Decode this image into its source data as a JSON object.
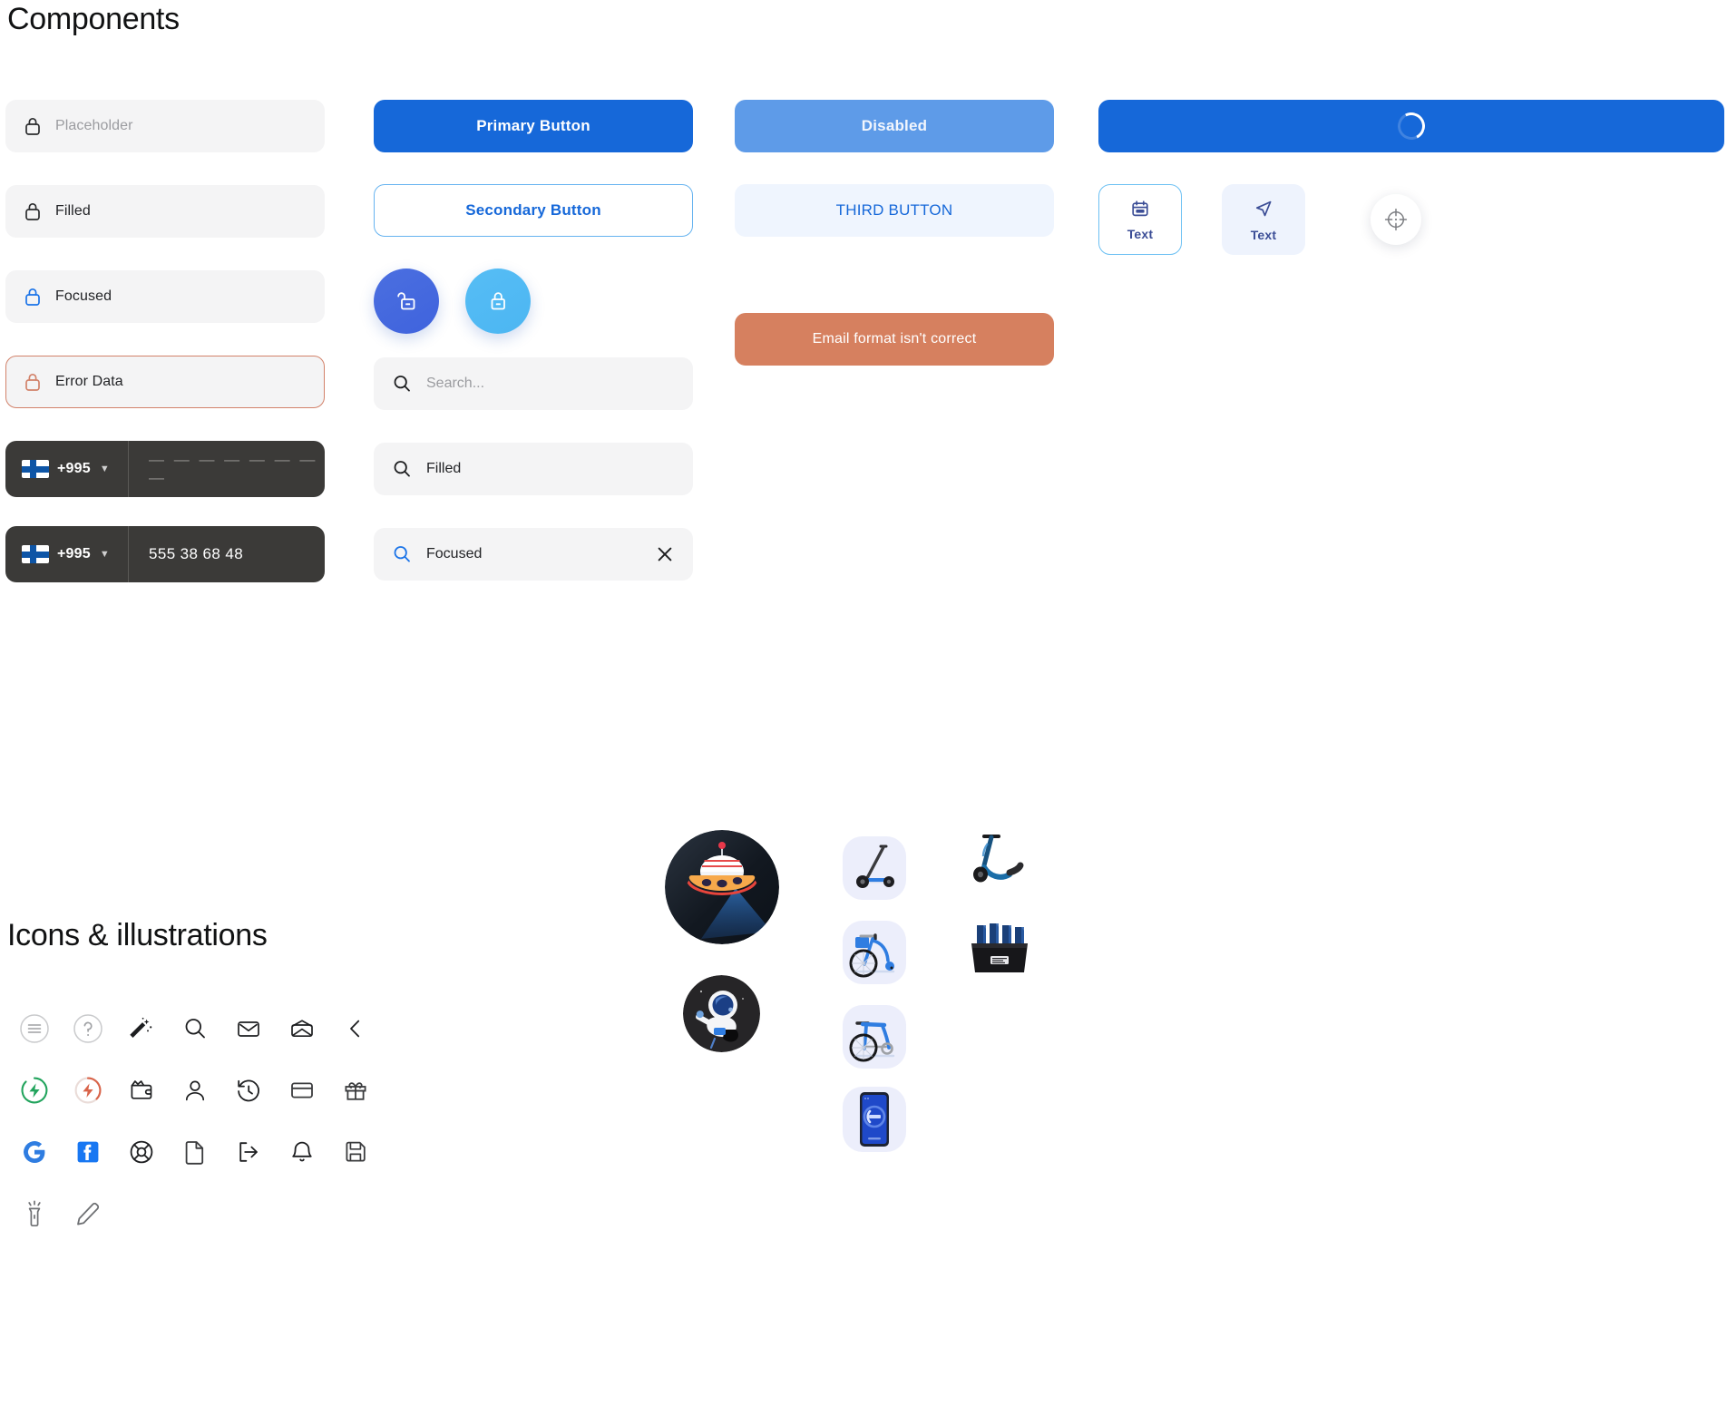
{
  "sections": {
    "components_title": "Components",
    "icons_title": "Icons & illustrations"
  },
  "colors": {
    "primary": "#1668d9",
    "primary_light": "#5e9be8",
    "secondary_border": "#66b3f0",
    "third_bg": "#eff5fe",
    "error": "#d6805f",
    "error_border": "#d2826a",
    "field_bg": "#f4f4f5",
    "phone_bg": "#3b3a38",
    "chip_label": "#3b4d96",
    "round_dark": "#4b6fe0",
    "round_light": "#56bdf5",
    "flag_blue": "#0e55a6",
    "charge_ok": "#22a45d",
    "charge_low": "#d9644a",
    "google_blue": "#2f7de1",
    "facebook_blue": "#1877f2"
  },
  "inputs": [
    {
      "name": "placeholder",
      "placeholder": "Placeholder",
      "value": "",
      "state": "empty",
      "icon": "lock-icon",
      "icon_color": "#2b2c2e"
    },
    {
      "name": "filled",
      "placeholder": "",
      "value": "Filled",
      "state": "filled",
      "icon": "lock-icon",
      "icon_color": "#2b2c2e"
    },
    {
      "name": "focused",
      "placeholder": "",
      "value": "Focused",
      "state": "focused",
      "icon": "lock-icon",
      "icon_color": "#1a73e8"
    },
    {
      "name": "error",
      "placeholder": "",
      "value": "Error Data",
      "state": "error",
      "icon": "lock-icon",
      "icon_color": "#d2826a"
    }
  ],
  "phone_inputs": [
    {
      "name": "phone-empty",
      "country_flag": "finland-flag-icon",
      "country_code": "+995",
      "value": "— — — — — — — —",
      "masked": true
    },
    {
      "name": "phone-filled",
      "country_flag": "finland-flag-icon",
      "country_code": "+995",
      "value": "555 38 68 48",
      "masked": false
    }
  ],
  "buttons": {
    "primary": "Primary Button",
    "secondary": "Secondary Button",
    "disabled": "Disabled",
    "third": "THIRD BUTTON",
    "error_message": "Email format isn't correct",
    "loading": ""
  },
  "round_buttons": [
    {
      "name": "unlock-button",
      "icon": "unlock-icon",
      "style": "dark"
    },
    {
      "name": "lock-button",
      "icon": "lock-icon",
      "style": "light"
    }
  ],
  "search_fields": [
    {
      "name": "search-placeholder",
      "placeholder": "Search...",
      "value": "",
      "state": "empty",
      "icon_color": "#1d1e20",
      "clearable": false
    },
    {
      "name": "search-filled",
      "placeholder": "",
      "value": "Filled",
      "state": "filled",
      "icon_color": "#1d1e20",
      "clearable": false
    },
    {
      "name": "search-focused",
      "placeholder": "",
      "value": "Focused",
      "state": "focused",
      "icon_color": "#1a73e8",
      "clearable": true
    }
  ],
  "chips": [
    {
      "name": "chip-calendar",
      "icon": "calendar-icon",
      "label": "Text",
      "style": "outline"
    },
    {
      "name": "chip-navigation",
      "icon": "navigation-arrow-icon",
      "label": "Text",
      "style": "fill"
    }
  ],
  "fab": {
    "name": "locate-button",
    "icon": "crosshair-target-icon"
  },
  "icon_grid": [
    [
      {
        "name": "menu-circle-icon"
      },
      {
        "name": "help-circle-icon"
      },
      {
        "name": "magic-wand-icon"
      },
      {
        "name": "search-icon"
      },
      {
        "name": "mail-closed-icon"
      },
      {
        "name": "mail-open-icon"
      },
      {
        "name": "chevron-left-icon"
      }
    ],
    [
      {
        "name": "battery-charged-icon"
      },
      {
        "name": "battery-low-icon"
      },
      {
        "name": "wallet-icon"
      },
      {
        "name": "user-icon"
      },
      {
        "name": "history-icon"
      },
      {
        "name": "credit-card-icon"
      },
      {
        "name": "gift-icon"
      }
    ],
    [
      {
        "name": "google-icon"
      },
      {
        "name": "facebook-icon"
      },
      {
        "name": "lifebuoy-support-icon"
      },
      {
        "name": "document-icon"
      },
      {
        "name": "logout-icon"
      },
      {
        "name": "bell-icon"
      },
      {
        "name": "save-floppy-icon"
      }
    ],
    [
      {
        "name": "flashlight-icon"
      },
      {
        "name": "pencil-edit-icon"
      }
    ]
  ],
  "illustrations": [
    {
      "name": "ufo-illustration",
      "shape": "circle"
    },
    {
      "name": "astronaut-illustration",
      "shape": "circle"
    },
    {
      "name": "scooter-tile-illustration",
      "shape": "tile"
    },
    {
      "name": "city-bike-tile-illustration",
      "shape": "tile"
    },
    {
      "name": "road-bike-tile-illustration",
      "shape": "tile"
    },
    {
      "name": "phone-app-tile-illustration",
      "shape": "tile"
    },
    {
      "name": "scooter-3d-illustration",
      "shape": "plain"
    },
    {
      "name": "battery-dock-illustration",
      "shape": "plain"
    }
  ]
}
